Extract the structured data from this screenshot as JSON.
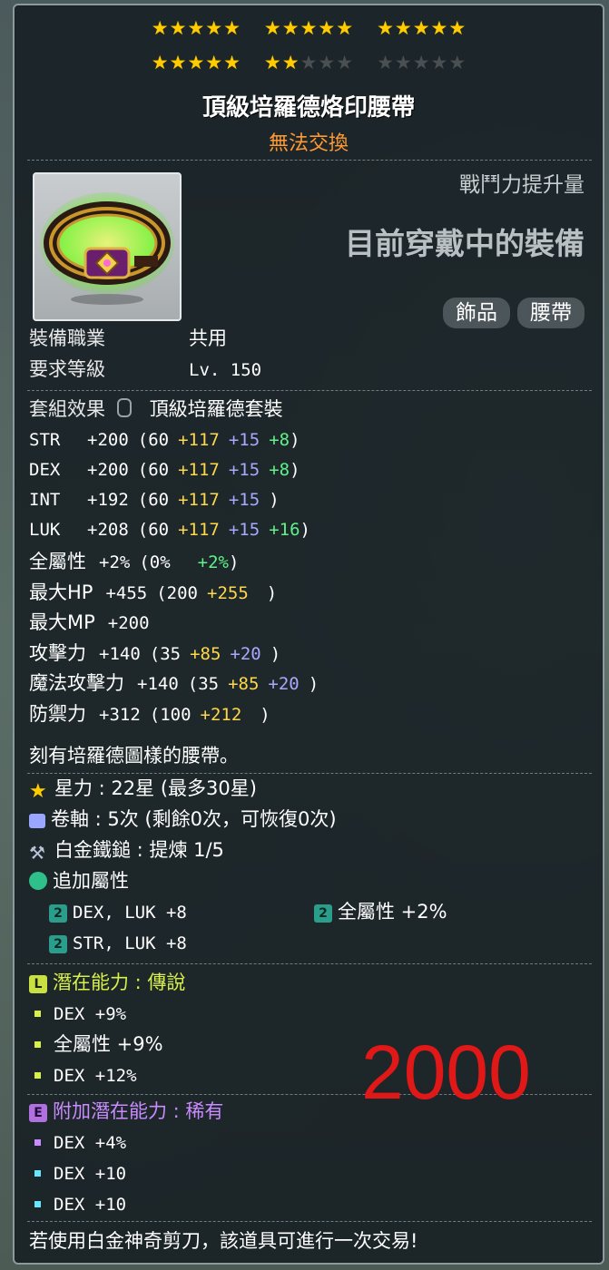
{
  "stars": {
    "filled": 22,
    "total": 30
  },
  "item": {
    "name": "頂級培羅德烙印腰帶",
    "trade_status": "無法交換",
    "power_label": "戰鬥力提升量",
    "wearing_label": "目前穿戴中的裝備",
    "tags": [
      "飾品",
      "腰帶"
    ]
  },
  "requirements": {
    "job_label": "裝備職業",
    "job_value": "共用",
    "level_label": "要求等級",
    "level_value": "Lv. 150"
  },
  "set_effect": {
    "label": "套組效果",
    "value": "頂級培羅德套裝"
  },
  "stats": [
    {
      "name": "STR",
      "total": "+200",
      "base": "(60",
      "p1": "+117",
      "p2": "+15",
      "p3": "+8",
      "close": ")"
    },
    {
      "name": "DEX",
      "total": "+200",
      "base": "(60",
      "p1": "+117",
      "p2": "+15",
      "p3": "+8",
      "close": ")"
    },
    {
      "name": "INT",
      "total": "+192",
      "base": "(60",
      "p1": "+117",
      "p2": "+15",
      "p3": "",
      "close": ")"
    },
    {
      "name": "LUK",
      "total": "+208",
      "base": "(60",
      "p1": "+117",
      "p2": "+15",
      "p3": "+16",
      "close": ")"
    }
  ],
  "stats2": [
    {
      "name": "全屬性",
      "total": "+2%",
      "base": "(0%",
      "yellow": "",
      "blue": "",
      "green": "+2%",
      "close": ")"
    },
    {
      "name": "最大HP",
      "total": "+455",
      "base": "(200",
      "yellow": "+255",
      "blue": "",
      "green": "",
      "close": ")"
    },
    {
      "name": "最大MP",
      "total": "+200",
      "base": "",
      "yellow": "",
      "blue": "",
      "green": "",
      "close": ""
    },
    {
      "name": "攻擊力",
      "total": "+140",
      "base": "(35",
      "yellow": "+85",
      "blue": "+20",
      "green": "",
      "close": ")"
    },
    {
      "name": "魔法攻擊力",
      "total": "+140",
      "base": "(35",
      "yellow": "+85",
      "blue": "+20",
      "green": "",
      "close": ")"
    },
    {
      "name": "防禦力",
      "total": "+312",
      "base": "(100",
      "yellow": "+212",
      "blue": "",
      "green": "",
      "close": ")"
    }
  ],
  "description": "刻有培羅德圖樣的腰帶。",
  "enhance": {
    "starforce": "星力 : 22星 (最多30星)",
    "scroll": "卷軸 : 5次 (剩餘0次，可恢復0次)",
    "hammer": "白金鐵鎚 : 提煉 1/5",
    "bonus_label": "追加屬性",
    "bonus_lines": [
      {
        "text": "DEX, LUK  +8",
        "grade": "2"
      },
      {
        "text": "全屬性 +2%",
        "grade": "2"
      },
      {
        "text": "STR, LUK  +8",
        "grade": "2"
      }
    ]
  },
  "potential": {
    "label": "潛在能力 : 傳說",
    "grade_letter": "L",
    "lines": [
      "DEX +9%",
      "全屬性 +9%",
      "DEX +12%"
    ]
  },
  "additional_potential": {
    "label": "附加潛在能力 : 稀有",
    "grade_letter": "E",
    "lines": [
      "DEX +4%",
      "DEX +10",
      "DEX +10"
    ]
  },
  "overlay_number": "2000",
  "footer": "若使用白金神奇剪刀，該道具可進行一次交易!",
  "colors": {
    "star_on": "#ffcc00",
    "trade_orange": "#ff9a33",
    "legendary": "#d8f04a",
    "rare": "#c98bff",
    "overlay_red": "#e01818"
  }
}
